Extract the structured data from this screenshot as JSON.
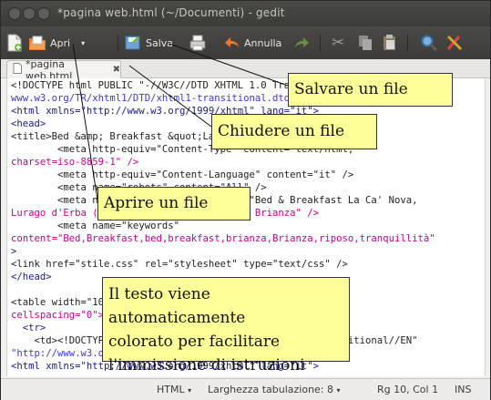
{
  "window": {
    "title": "*pagina web.html (~/Documenti) - gedit"
  },
  "toolbar": {
    "open_label": "Apri",
    "save_label": "Salva",
    "undo_label": "Annulla"
  },
  "tab": {
    "label": "*pagina web.html"
  },
  "editor": {
    "lines": [
      "<!DOCTYPE html PUBLIC \"-//W3C//DTD XHTML 1.0 Transitional//EN\" \"http://",
      "www.w3.org/TR/xhtml1/DTD/xhtml1-transitional.dtd\">",
      "<html xmlns=\"http://www.w3.org/1999/xhtml\" lang=\"it\">",
      "<head>",
      "<title>Bed &amp; Breakfast &quot;La Ca' Nova&quot;</title>",
      "        <meta http-equiv=\"Content-Type\" content=\"text/html;",
      "charset=iso-8859-1\" />",
      "        <meta http-equiv=\"Content-Language\" content=\"it\" />",
      "        <meta name=\"robots\" content=\"All\" />",
      "        <meta name=\"description\" content=\"Bed & Breakfast La Ca' Nova,",
      "Lurago d'Erba (CO), nel cuore della verde Brianza\" />",
      "        <meta name=\"keywords\"",
      "content=\"Bed,Breakfast,bed,breakfast,brianza,Brianza,riposo,tranquillità\"",
      ">",
      "<link href=\"stile.css\" rel=\"stylesheet\" type=\"text/css\" />",
      "</head>",
      "",
      "<table width=\"100%\" border=\"0\" cellpadding=\"0\"",
      "cellspacing=\"0\">",
      "  <tr>",
      "    <td><!DOCTYPE html PUBLIC \"-//W3C//DTD XHTML 1.0 Transitional//EN\"",
      "\"http://www.w3.org/TR/xhtml1/DTD/xhtml1-transitional.dtd\">",
      "<html xmlns=\"http://www.w3.org/1999/xhtml\" lang=\"it\">"
    ]
  },
  "callouts": {
    "save": "Salvare un file",
    "close": "Chiudere un file",
    "open": "Aprire un file",
    "syntax_line1": "Il testo viene automaticamente",
    "syntax_line2": "colorato per facilitare",
    "syntax_line3": "l'immissione di istruzioni"
  },
  "statusbar": {
    "language": "HTML",
    "tab_width": "Larghezza tabulazione: 8",
    "position": "Rg 10, Col 1",
    "mode": "INS"
  }
}
